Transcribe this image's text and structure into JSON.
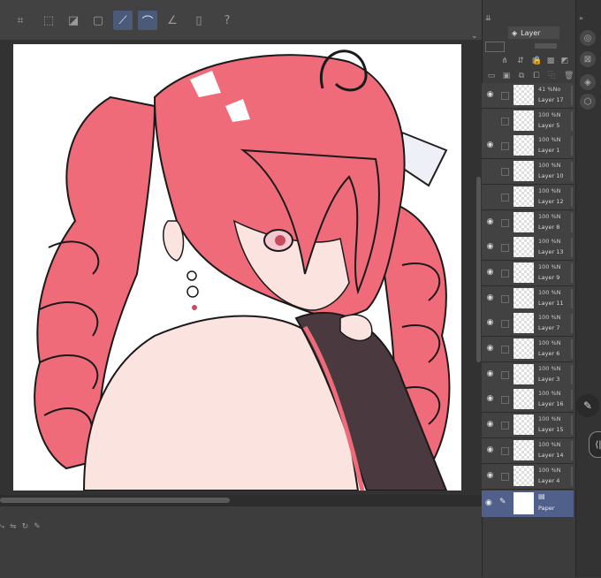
{
  "toolbar": {
    "buttons": [
      {
        "icon": "crop-icon",
        "glyph": "⌗"
      },
      {
        "icon": "transform-icon",
        "glyph": "⬚"
      },
      {
        "icon": "transparency-icon",
        "glyph": "◪"
      },
      {
        "icon": "frame-icon",
        "glyph": "▢"
      },
      {
        "icon": "ruler-pen-icon",
        "glyph": "⟋",
        "active": true
      },
      {
        "icon": "curve-icon",
        "glyph": "⌒",
        "active": true
      },
      {
        "icon": "line-icon",
        "glyph": "∠"
      },
      {
        "icon": "device-icon",
        "glyph": "▯"
      },
      {
        "icon": "help-icon",
        "glyph": "?"
      }
    ]
  },
  "layer_panel": {
    "tab_label": "Layer",
    "layers": [
      {
        "opacity": "41 %No",
        "name": "Layer 17",
        "visible": true
      },
      {
        "opacity": "100 %N",
        "name": "Layer 5",
        "visible": false
      },
      {
        "opacity": "100 %N",
        "name": "Layer 1",
        "visible": true
      },
      {
        "opacity": "100 %N",
        "name": "Layer 10",
        "visible": false
      },
      {
        "opacity": "100 %N",
        "name": "Layer 12",
        "visible": false
      },
      {
        "opacity": "100 %N",
        "name": "Layer 8",
        "visible": true
      },
      {
        "opacity": "100 %N",
        "name": "Layer 13",
        "visible": true
      },
      {
        "opacity": "100 %N",
        "name": "Layer 9",
        "visible": true
      },
      {
        "opacity": "100 %N",
        "name": "Layer 11",
        "visible": true
      },
      {
        "opacity": "100 %N",
        "name": "Layer 7",
        "visible": true
      },
      {
        "opacity": "100 %N",
        "name": "Layer 6",
        "visible": true
      },
      {
        "opacity": "100 %N",
        "name": "Layer 3",
        "visible": true
      },
      {
        "opacity": "100 %N",
        "name": "Layer 16",
        "visible": true
      },
      {
        "opacity": "100 %N",
        "name": "Layer 15",
        "visible": true
      },
      {
        "opacity": "100 %N",
        "name": "Layer 14",
        "visible": true
      },
      {
        "opacity": "100 %N",
        "name": "Layer 4",
        "visible": true
      }
    ],
    "paper_layer": {
      "name": "Paper",
      "visible": true
    }
  },
  "colors": {
    "hair": "#ef6b7a",
    "hair_dark": "#c94a5c",
    "skin": "#fbe3df",
    "cloth": "#4a3a40",
    "accent": "#51608a"
  }
}
